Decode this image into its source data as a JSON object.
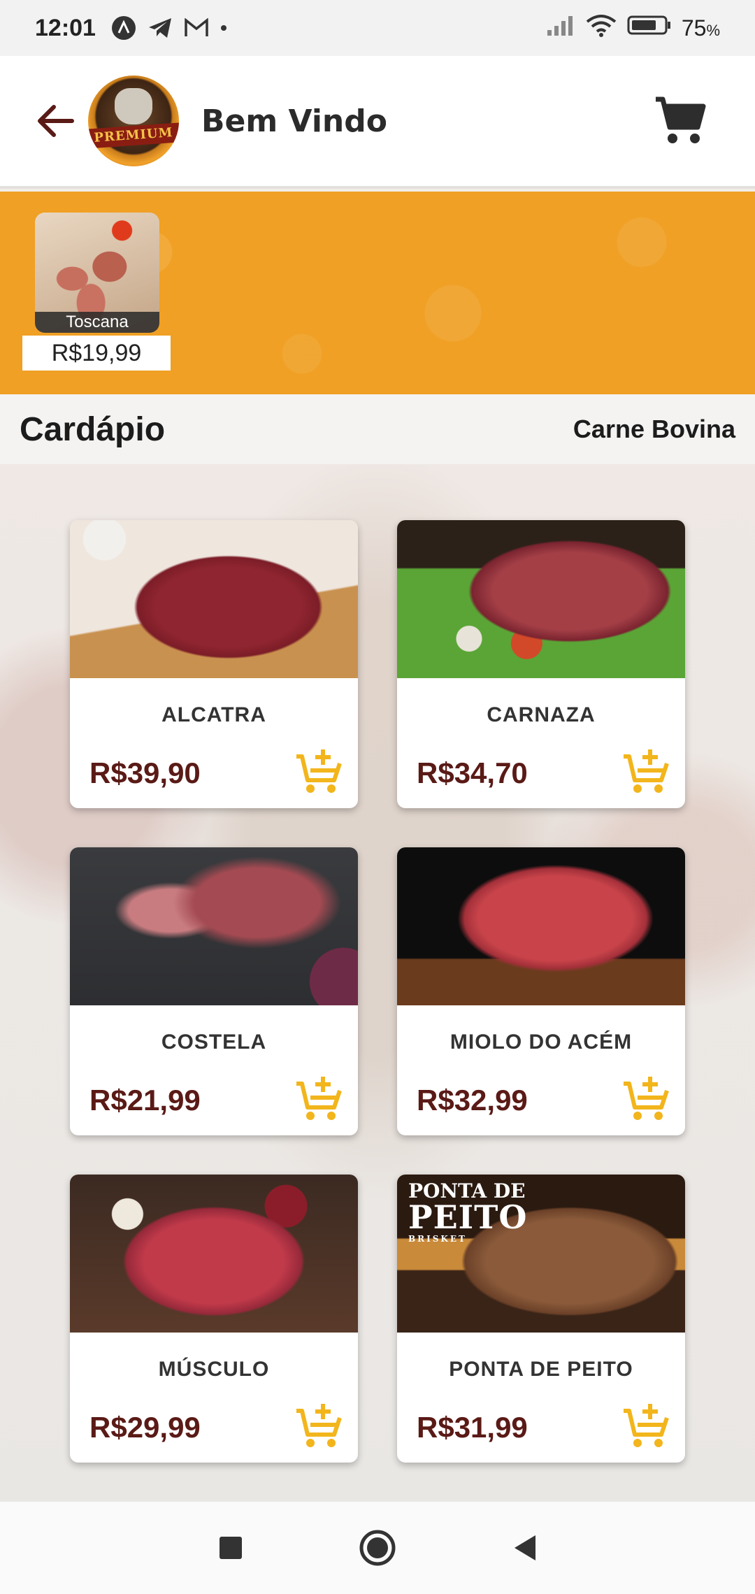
{
  "status_bar": {
    "time": "12:01",
    "battery_percent": "75",
    "battery_unit": "%"
  },
  "header": {
    "title": "Bem Vindo",
    "logo_text": "PREMIUM"
  },
  "promo": {
    "items": [
      {
        "name": "Toscana",
        "price": "R$19,99"
      }
    ]
  },
  "menu": {
    "title": "Cardápio",
    "category": "Carne Bovina"
  },
  "products": [
    {
      "name": "ALCATRA",
      "price": "R$39,90"
    },
    {
      "name": "CARNAZA",
      "price": "R$34,70"
    },
    {
      "name": "COSTELA",
      "price": "R$21,99"
    },
    {
      "name": "MIOLO DO ACÉM",
      "price": "R$32,99"
    },
    {
      "name": "MÚSCULO",
      "price": "R$29,99"
    },
    {
      "name": "PONTA DE PEITO",
      "price": "R$31,99"
    }
  ],
  "product_image_text": {
    "ponta_line1": "PONTA DE",
    "ponta_line2": "PEITO",
    "ponta_line3": "BRISKET"
  },
  "colors": {
    "accent_orange": "#f0a024",
    "price_maroon": "#5a1a16",
    "cart_icon_yellow": "#f2b51c",
    "back_arrow": "#5a1a16"
  },
  "icons": {
    "back": "arrow-left-icon",
    "cart": "shopping-cart-icon",
    "add_to_cart": "cart-plus-icon"
  }
}
